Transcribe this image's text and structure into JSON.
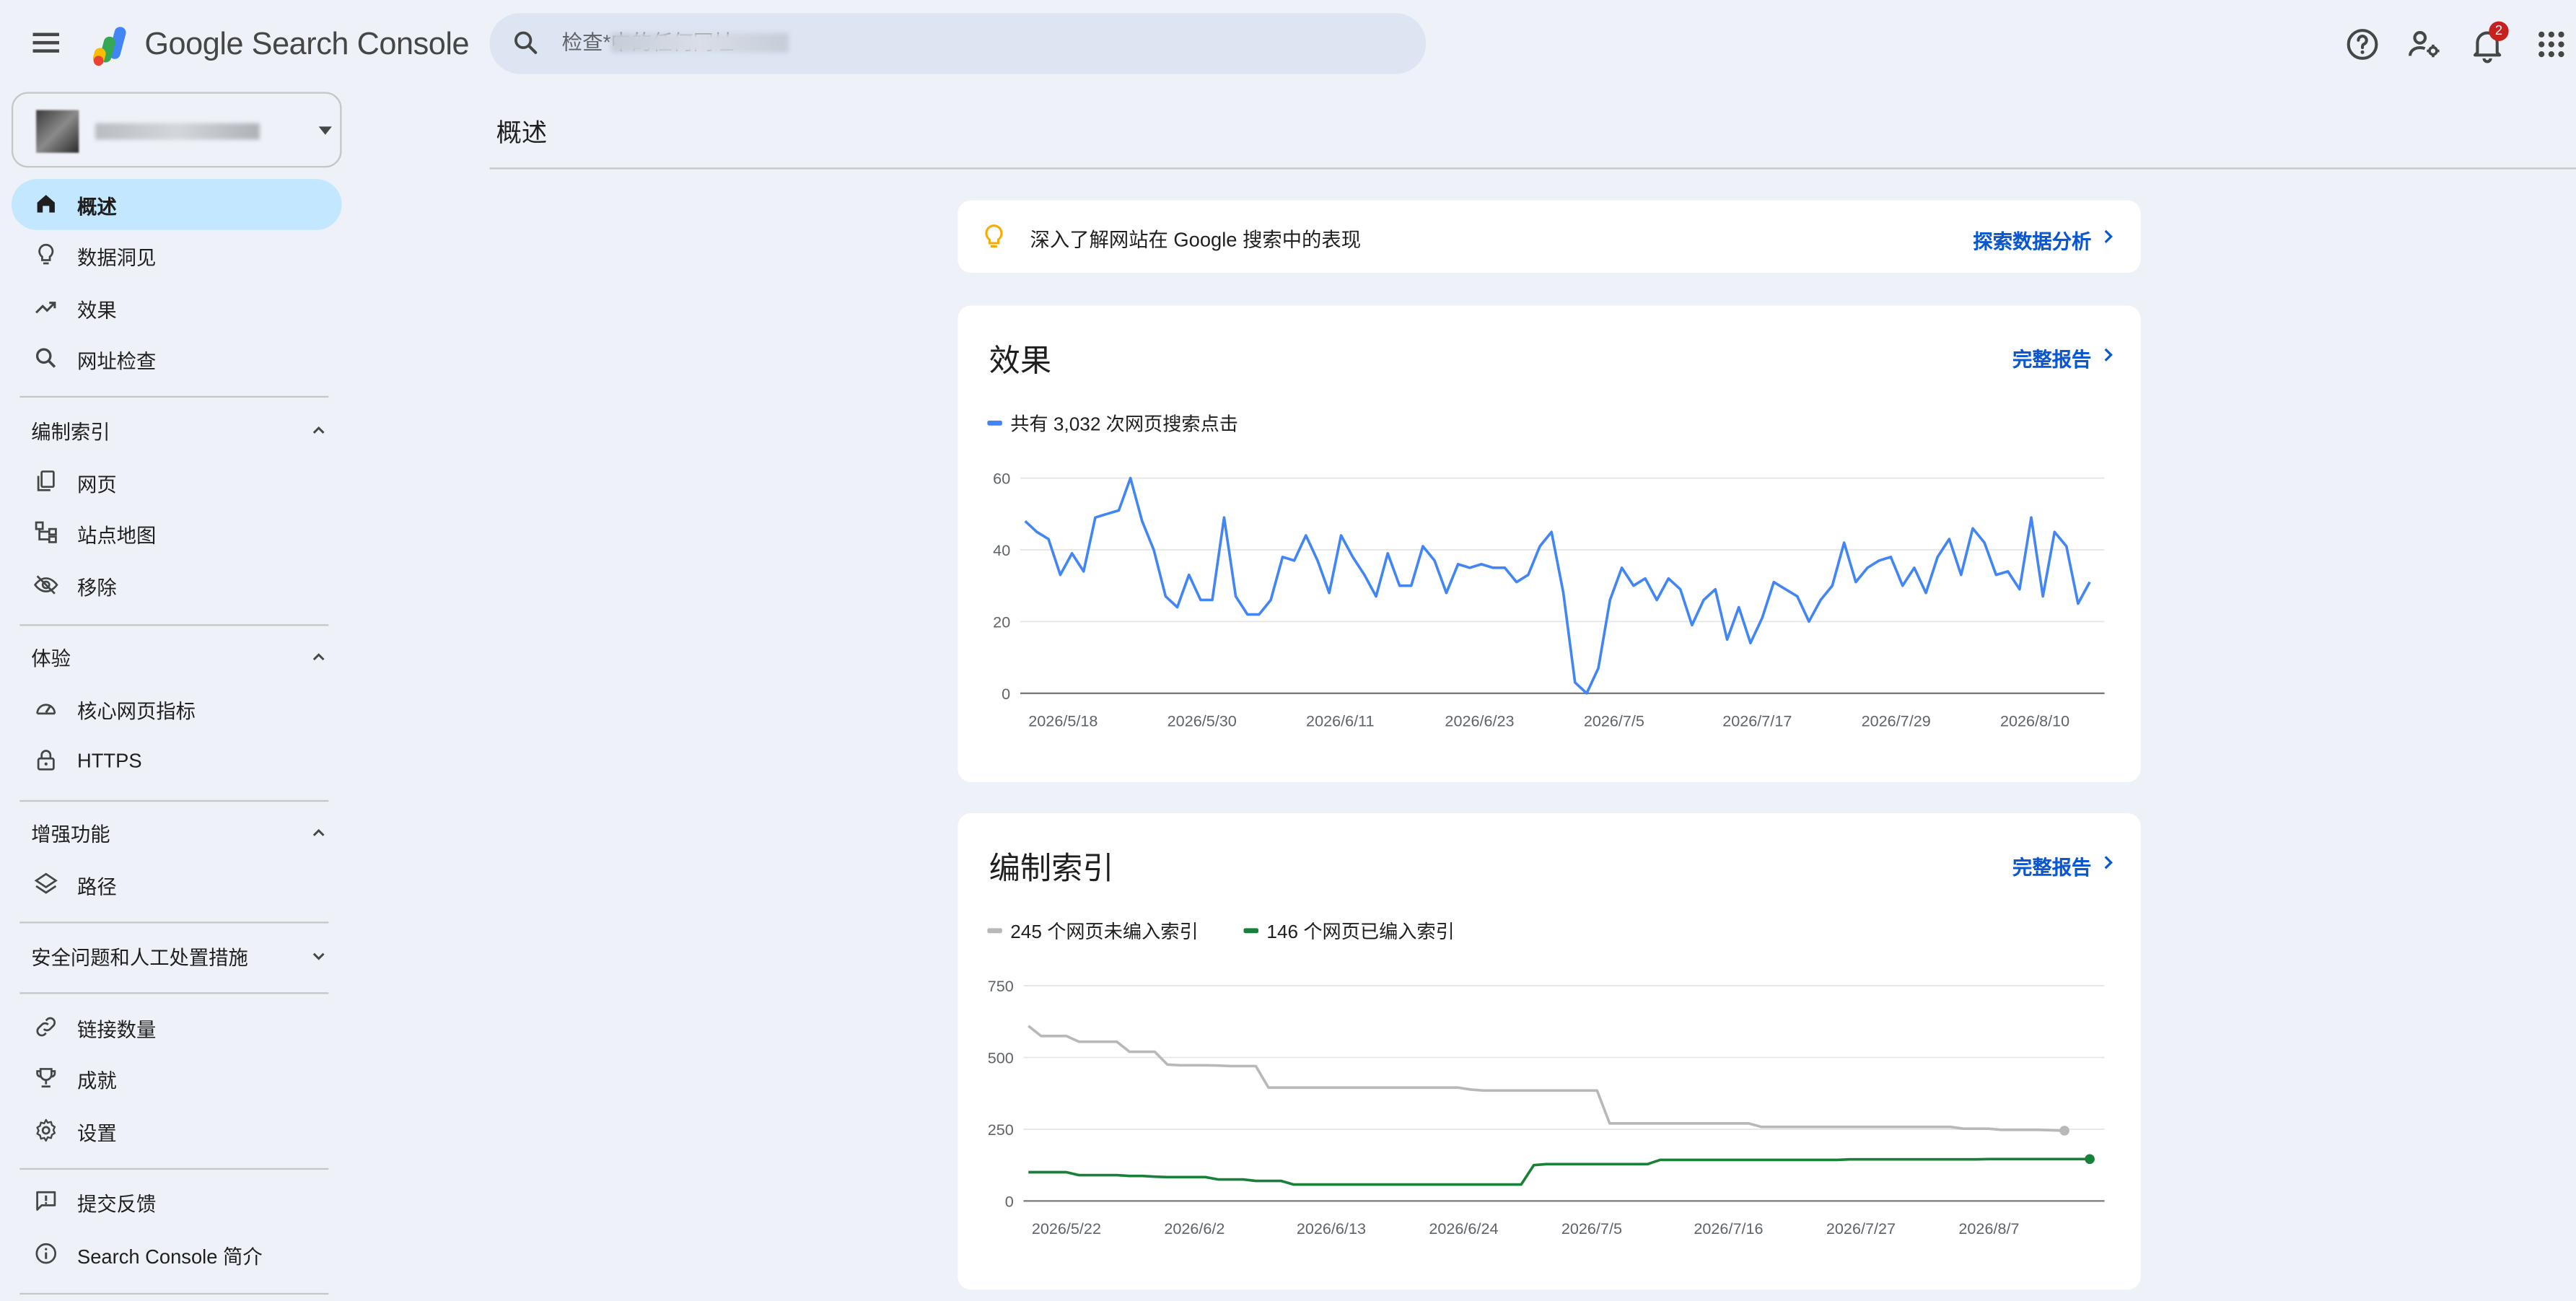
{
  "header": {
    "product_name": "Google Search Console",
    "search_placeholder": "检查*中的任何网址",
    "notification_count": "2"
  },
  "sidebar": {
    "top_items": [
      {
        "label": "概述",
        "icon": "home-icon",
        "active": true
      },
      {
        "label": "数据洞见",
        "icon": "lightbulb-icon"
      },
      {
        "label": "效果",
        "icon": "trending-up-icon"
      },
      {
        "label": "网址检查",
        "icon": "search-icon"
      }
    ],
    "sections": [
      {
        "label": "编制索引",
        "expanded": true,
        "items": [
          {
            "label": "网页",
            "icon": "pages-icon"
          },
          {
            "label": "站点地图",
            "icon": "sitemap-icon"
          },
          {
            "label": "移除",
            "icon": "eye-off-icon"
          }
        ]
      },
      {
        "label": "体验",
        "expanded": true,
        "items": [
          {
            "label": "核心网页指标",
            "icon": "speed-icon"
          },
          {
            "label": "HTTPS",
            "icon": "lock-icon"
          }
        ]
      },
      {
        "label": "增强功能",
        "expanded": true,
        "items": [
          {
            "label": "路径",
            "icon": "layers-icon"
          }
        ]
      },
      {
        "label": "安全问题和人工处置措施",
        "expanded": false,
        "items": []
      }
    ],
    "bottom_items": [
      {
        "label": "链接数量",
        "icon": "link-icon"
      },
      {
        "label": "成就",
        "icon": "trophy-icon"
      },
      {
        "label": "设置",
        "icon": "gear-icon"
      }
    ],
    "footer_items": [
      {
        "label": "提交反馈",
        "icon": "feedback-icon"
      },
      {
        "label": "Search Console 简介",
        "icon": "info-icon"
      }
    ]
  },
  "main": {
    "page_title": "概述",
    "tip": {
      "text": "深入了解网站在 Google 搜索中的表现",
      "link": "探索数据分析"
    },
    "performance": {
      "title": "效果",
      "link": "完整报告",
      "legend": "共有 3,032 次网页搜索点击"
    },
    "indexing": {
      "title": "编制索引",
      "link": "完整报告",
      "legend_not_indexed": "245 个网页未编入索引",
      "legend_indexed": "146 个网页已编入索引"
    }
  },
  "colors": {
    "accent": "#0b57d0",
    "clicks_line": "#4285f4",
    "not_indexed_line": "#b8b8b8",
    "indexed_line": "#188038",
    "active_nav": "#c2e7ff"
  },
  "chart_data": [
    {
      "type": "line",
      "title": "效果",
      "series": [
        {
          "name": "共有 3,032 次网页搜索点击",
          "values": [
            48,
            45,
            43,
            33,
            39,
            34,
            49,
            50,
            51,
            60,
            48,
            40,
            27,
            24,
            33,
            26,
            26,
            49,
            27,
            22,
            22,
            26,
            38,
            37,
            44,
            37,
            28,
            44,
            38,
            33,
            27,
            39,
            30,
            30,
            41,
            37,
            28,
            36,
            35,
            36,
            35,
            35,
            31,
            33,
            41,
            45,
            28,
            3,
            0,
            7,
            26,
            35,
            30,
            32,
            26,
            32,
            29,
            19,
            26,
            29,
            15,
            24,
            14,
            21,
            31,
            29,
            27,
            20,
            26,
            30,
            42,
            31,
            35,
            37,
            38,
            30,
            35,
            28,
            38,
            43,
            33,
            46,
            42,
            33,
            34,
            29,
            49,
            27,
            45,
            41,
            25,
            31
          ]
        }
      ],
      "x_tick_labels": [
        "2026/5/18",
        "2026/5/30",
        "2026/6/11",
        "2026/6/23",
        "2026/7/5",
        "2026/7/17",
        "2026/7/29",
        "2026/8/10"
      ],
      "y_ticks": [
        0,
        20,
        40,
        60
      ],
      "ylim": [
        0,
        60
      ]
    },
    {
      "type": "line",
      "title": "编制索引",
      "series": [
        {
          "name": "245 个网页未编入索引",
          "values": [
            610,
            575,
            575,
            575,
            555,
            555,
            555,
            555,
            520,
            520,
            520,
            475,
            473,
            473,
            473,
            472,
            470,
            470,
            470,
            395,
            395,
            395,
            395,
            395,
            395,
            395,
            395,
            395,
            395,
            395,
            395,
            395,
            395,
            395,
            395,
            388,
            385,
            385,
            385,
            385,
            385,
            385,
            385,
            385,
            385,
            385,
            270,
            270,
            270,
            270,
            270,
            270,
            270,
            270,
            270,
            270,
            270,
            270,
            258,
            258,
            258,
            258,
            258,
            258,
            258,
            258,
            258,
            258,
            258,
            258,
            258,
            258,
            258,
            258,
            252,
            252,
            252,
            248,
            248,
            248,
            248,
            246,
            245
          ]
        },
        {
          "name": "146 个网页已编入索引",
          "values": [
            100,
            100,
            100,
            100,
            90,
            90,
            90,
            90,
            87,
            87,
            85,
            83,
            83,
            83,
            83,
            75,
            75,
            75,
            70,
            70,
            70,
            57,
            57,
            57,
            57,
            57,
            57,
            57,
            57,
            57,
            57,
            57,
            57,
            57,
            57,
            57,
            57,
            57,
            57,
            57,
            125,
            128,
            128,
            128,
            128,
            128,
            128,
            128,
            128,
            128,
            143,
            143,
            143,
            143,
            143,
            143,
            143,
            143,
            143,
            143,
            143,
            143,
            143,
            143,
            143,
            145,
            145,
            145,
            145,
            145,
            145,
            145,
            145,
            145,
            145,
            145,
            146,
            146,
            146,
            146,
            146,
            146,
            146,
            146,
            146
          ]
        }
      ],
      "x_tick_labels": [
        "2026/5/22",
        "2026/6/2",
        "2026/6/13",
        "2026/6/24",
        "2026/7/5",
        "2026/7/16",
        "2026/7/27",
        "2026/8/7"
      ],
      "y_ticks": [
        0,
        250,
        500,
        750
      ],
      "ylim": [
        0,
        750
      ]
    }
  ]
}
